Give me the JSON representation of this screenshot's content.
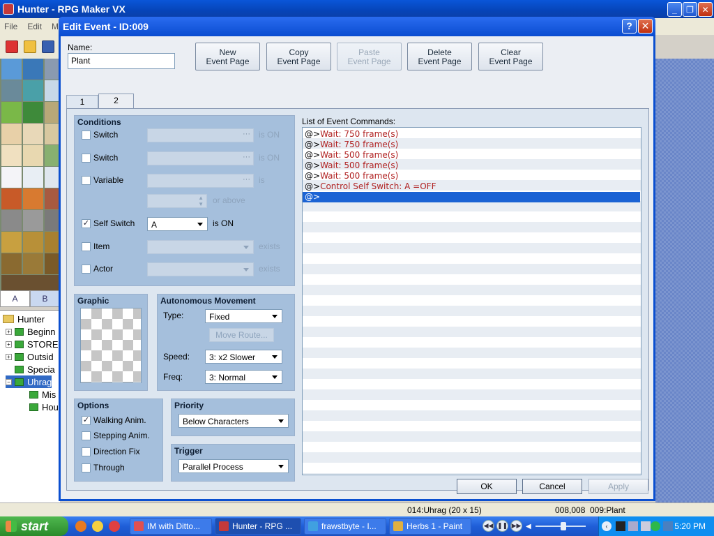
{
  "app": {
    "title": "Hunter - RPG Maker VX",
    "menu": [
      "File",
      "Edit",
      "M"
    ],
    "palette_tabs": [
      "A",
      "B"
    ],
    "tree": [
      {
        "label": "Hunter",
        "kind": "root"
      },
      {
        "label": "Beginn",
        "kind": "map",
        "expander": "+"
      },
      {
        "label": "STORE",
        "kind": "map",
        "expander": "+"
      },
      {
        "label": "Outsid",
        "kind": "map",
        "expander": "+"
      },
      {
        "label": "Specia",
        "kind": "map",
        "expander": ""
      },
      {
        "label": "Uhrag",
        "kind": "map",
        "expander": "−",
        "selected": true
      },
      {
        "label": "Mis",
        "kind": "map",
        "expander": ""
      },
      {
        "label": "Hou",
        "kind": "map",
        "expander": ""
      }
    ],
    "status": {
      "map": "014:Uhrag (20 x 15)",
      "coords": "008,008",
      "event": "009:Plant"
    }
  },
  "dialog": {
    "title": "Edit Event - ID:009",
    "help": "?",
    "close": "✕",
    "name_label": "Name:",
    "name_value": "Plant",
    "buttons": [
      {
        "label": "New\nEvent Page",
        "enabled": true
      },
      {
        "label": "Copy\nEvent Page",
        "enabled": true
      },
      {
        "label": "Paste\nEvent Page",
        "enabled": false
      },
      {
        "label": "Delete\nEvent Page",
        "enabled": true
      },
      {
        "label": "Clear\nEvent Page",
        "enabled": true
      }
    ],
    "tabs": [
      "1",
      "2"
    ],
    "active_tab": "2",
    "conditions": {
      "title": "Conditions",
      "switch1": {
        "label": "Switch",
        "checked": false,
        "value": "",
        "suffix": "is ON"
      },
      "switch2": {
        "label": "Switch",
        "checked": false,
        "value": "",
        "suffix": "is ON"
      },
      "variable": {
        "label": "Variable",
        "checked": false,
        "value": "",
        "suffix": "is",
        "or_above": "or above"
      },
      "self_switch": {
        "label": "Self Switch",
        "checked": true,
        "value": "A",
        "suffix": "is ON"
      },
      "item": {
        "label": "Item",
        "checked": false,
        "value": "",
        "suffix": "exists"
      },
      "actor": {
        "label": "Actor",
        "checked": false,
        "value": "",
        "suffix": "exists"
      }
    },
    "graphic": {
      "title": "Graphic"
    },
    "movement": {
      "title": "Autonomous Movement",
      "type_label": "Type:",
      "type_value": "Fixed",
      "move_route": "Move Route...",
      "speed_label": "Speed:",
      "speed_value": "3: x2 Slower",
      "freq_label": "Freq:",
      "freq_value": "3: Normal"
    },
    "options": {
      "title": "Options",
      "items": [
        {
          "label": "Walking Anim.",
          "checked": true
        },
        {
          "label": "Stepping Anim.",
          "checked": false
        },
        {
          "label": "Direction Fix",
          "checked": false
        },
        {
          "label": "Through",
          "checked": false
        }
      ]
    },
    "priority": {
      "title": "Priority",
      "value": "Below Characters"
    },
    "trigger": {
      "title": "Trigger",
      "value": "Parallel Process"
    },
    "commands": {
      "title": "List of Event Commands:",
      "items": [
        {
          "prefix": "@>",
          "text": "Wait: 750 frame(s)"
        },
        {
          "prefix": "@>",
          "text": "Wait: 750 frame(s)"
        },
        {
          "prefix": "@>",
          "text": "Wait: 500 frame(s)"
        },
        {
          "prefix": "@>",
          "text": "Wait: 500 frame(s)"
        },
        {
          "prefix": "@>",
          "text": "Wait: 500 frame(s)"
        },
        {
          "prefix": "@>",
          "text": "Control Self Switch: A =OFF"
        },
        {
          "prefix": "@>",
          "text": "",
          "selected": true
        }
      ]
    },
    "ok": "OK",
    "cancel": "Cancel",
    "apply": "Apply"
  },
  "taskbar": {
    "start": "start",
    "tasks": [
      {
        "label": "IM with Ditto...",
        "active": false
      },
      {
        "label": "Hunter - RPG ...",
        "active": true
      },
      {
        "label": "frawstbyte - I...",
        "active": false
      },
      {
        "label": "Herbs 1 - Paint",
        "active": false
      }
    ],
    "clock": "5:20 PM"
  }
}
